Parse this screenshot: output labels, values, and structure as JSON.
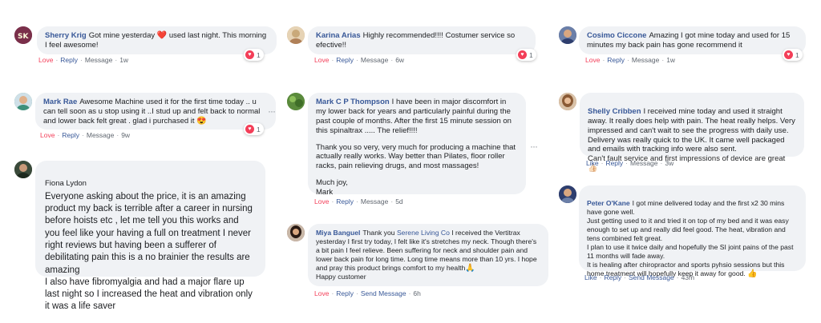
{
  "actions": {
    "love": "Love",
    "reply": "Reply",
    "message": "Message",
    "send_message": "Send Message",
    "like": "Like",
    "sep": "·"
  },
  "more_glyph": "···",
  "comments": [
    {
      "name": "Sherry Krig",
      "text": "Got mine yesterday",
      "emoji": "❤️",
      "text_after": "used last night. This morning I feel awesome!",
      "reaction_count": "1",
      "time": "1w",
      "avatar_color": "#7a2f4a"
    },
    {
      "name": "Karina Arias",
      "text": "Highly recommended!!!! Costumer service so efective!!",
      "reaction_count": "1",
      "time": "6w",
      "avatar_color": "#c9a97a"
    },
    {
      "name": "Cosimo Ciccone",
      "text": "Amazing I got mine today and used for 15 minutes my back pain has gone recommend it",
      "reaction_count": "1",
      "time": "1w",
      "avatar_color": "#4a5d8a"
    },
    {
      "name": "Mark Rae",
      "text": "Awesome Machine used it for the first time today .. u can tell soon as u stop using it ..I stud up and felt back to normal and lower back felt great . glad i purchased it",
      "emoji": "😍",
      "reaction_count": "1",
      "time": "9w",
      "avatar_color": "#3d8f7a"
    },
    {
      "name": "Mark C P Thompson",
      "paragraphs": [
        "I have been in major discomfort in my lower back for years and particularly painful during the past couple of months. After the first 15 minute session on this spinaltrax ..... The relief!!!!",
        "Thank you so very, very much for producing a machine that actually really works. Way better than Pilates, floor roller racks, pain relieving drugs, and most massages!",
        "Much joy,\nMark"
      ],
      "time": "5d",
      "avatar_color": "#5a8a3c"
    },
    {
      "name": "Shelly Cribben",
      "text": "I received mine today and used it straight away. It really does help with pain. The heat really helps. Very impressed and can't wait to see the progress with daily use. Delivery was really quick to the UK. It came well packaged and emails with tracking info were also sent.\nCan't fault service and first impressions of device are great",
      "emoji": "👍🏻",
      "time": "3w",
      "avatar_color": "#a8734f"
    },
    {
      "name": "Fiona Lydon",
      "text": "Everyone asking about the price, it is an amazing product my back is terrible after a career in nursing before hoists etc , let me tell you this works and you feel like your having a full on treatment I never right reviews but having been a sufferer of debilitating pain this is a no brainier the results are amazing\nI also have fibromyalgia and had a major flare up last night so I increased the heat and vibration only it was a life saver",
      "avatar_color": "#3a4a3a"
    },
    {
      "name": "Peter O'Kane",
      "text": "I got mine delivered today and the first x2 30 mins have gone well.\nJust getting used to it and tried it on top of my bed and it was easy enough to set up and really did feel good. The heat, vibration and tens combined felt great.\nI plan to use it twice daily and hopefully the SI joint pains of the past 11 months will fade away.\nIt is healing after chiropractor and sports pyhsio sessions but this home treatment will hopefully keep it away for good.",
      "emoji": "👍",
      "time": "43m",
      "avatar_color": "#2e3e6e"
    },
    {
      "name": "Miya Banguel",
      "text": "Thank you",
      "mention": "Serene Living Co",
      "text_after": "I received the Vertitrax yesterday I first try today, I felt like it's stretches my neck. Though there's a bit pain I feel relieve. Been suffering for neck and shoulder pain and lower back pain for long time. Long time means more than 10 yrs. I hope and pray this product brings comfort to my health",
      "emoji": "🙏",
      "text_end": "Happy customer",
      "time": "6h",
      "avatar_color": "#8a5a5a"
    }
  ]
}
